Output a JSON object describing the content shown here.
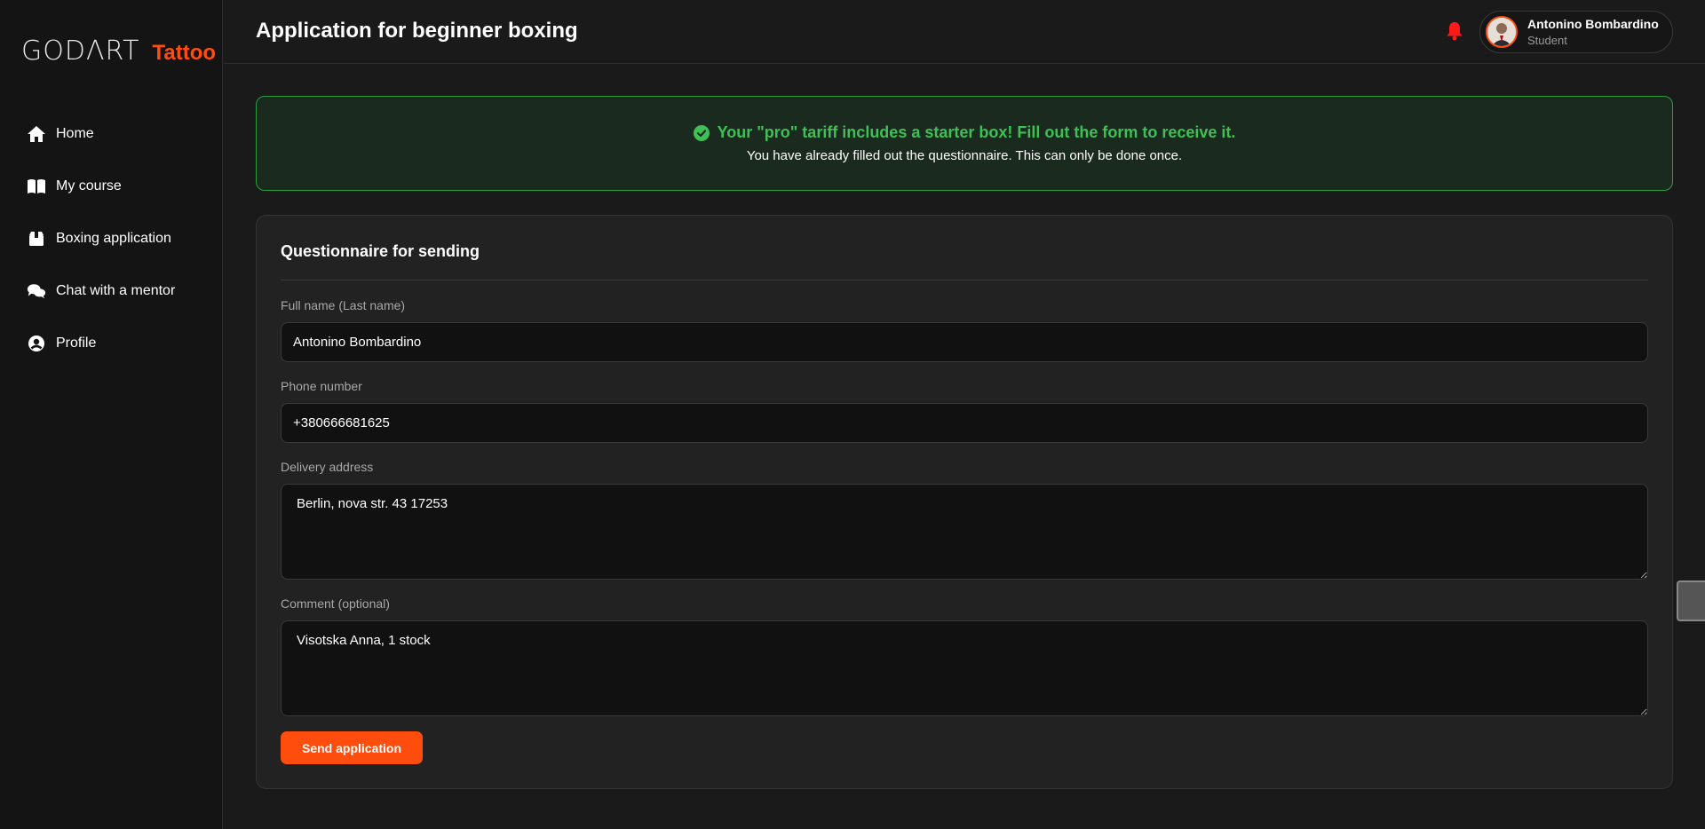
{
  "brand": {
    "logo_main": "GODΛRT",
    "logo_accent": "Tattoo",
    "accent_color": "#ff4d0d"
  },
  "sidebar": {
    "items": [
      {
        "label": "Home",
        "icon": "home-icon"
      },
      {
        "label": "My course",
        "icon": "book-icon"
      },
      {
        "label": "Boxing application",
        "icon": "box-icon"
      },
      {
        "label": "Chat with a mentor",
        "icon": "chat-icon"
      },
      {
        "label": "Profile",
        "icon": "user-circle-icon"
      }
    ]
  },
  "header": {
    "title": "Application for beginner boxing",
    "user": {
      "name": "Antonino Bombardino",
      "role": "Student"
    },
    "bell_color": "#ff1a1a"
  },
  "notice": {
    "headline": "Your \"pro\" tariff includes a starter box! Fill out the form to receive it.",
    "subtext": "You have already filled out the questionnaire. This can only be done once.",
    "color": "#3fc057"
  },
  "form": {
    "title": "Questionnaire for sending",
    "fields": {
      "full_name": {
        "label": "Full name (Last name)",
        "value": "Antonino Bombardino"
      },
      "phone": {
        "label": "Phone number",
        "value": "+380666681625"
      },
      "address": {
        "label": "Delivery address",
        "value": "Berlin, nova str. 43 17253"
      },
      "comment": {
        "label": "Comment (optional)",
        "value": "Visotska Anna, 1 stock"
      }
    },
    "submit_label": "Send application"
  }
}
